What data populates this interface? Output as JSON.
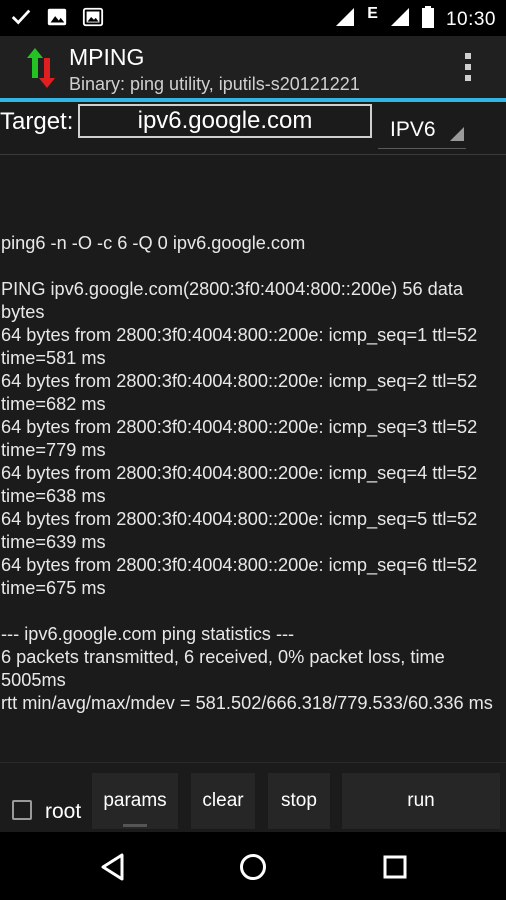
{
  "status_bar": {
    "network_label": "E",
    "time": "10:30"
  },
  "app": {
    "title": "MPING",
    "subtitle": "Binary: ping utility, iputils-s20121221"
  },
  "target": {
    "label": "Target:",
    "value": "ipv6.google.com",
    "protocol": "IPV6"
  },
  "output_lines": [
    "ping6 -n -O -c 6 -Q 0 ipv6.google.com",
    "",
    "PING ipv6.google.com(2800:3f0:4004:800::200e) 56 data bytes",
    "64 bytes from 2800:3f0:4004:800::200e: icmp_seq=1 ttl=52 time=581 ms",
    "64 bytes from 2800:3f0:4004:800::200e: icmp_seq=2 ttl=52 time=682 ms",
    "64 bytes from 2800:3f0:4004:800::200e: icmp_seq=3 ttl=52 time=779 ms",
    "64 bytes from 2800:3f0:4004:800::200e: icmp_seq=4 ttl=52 time=638 ms",
    "64 bytes from 2800:3f0:4004:800::200e: icmp_seq=5 ttl=52 time=639 ms",
    "64 bytes from 2800:3f0:4004:800::200e: icmp_seq=6 ttl=52 time=675 ms",
    "",
    "--- ipv6.google.com ping statistics ---",
    "6 packets transmitted, 6 received, 0% packet loss, time 5005ms",
    "rtt min/avg/max/mdev = 581.502/666.318/779.533/60.336 ms"
  ],
  "controls": {
    "root_label": "root",
    "root_checked": false,
    "params_label": "params",
    "clear_label": "clear",
    "stop_label": "stop",
    "run_label": "run"
  },
  "colors": {
    "accent": "#33b5e5",
    "logo_up": "#22c322",
    "logo_down": "#e02020"
  }
}
